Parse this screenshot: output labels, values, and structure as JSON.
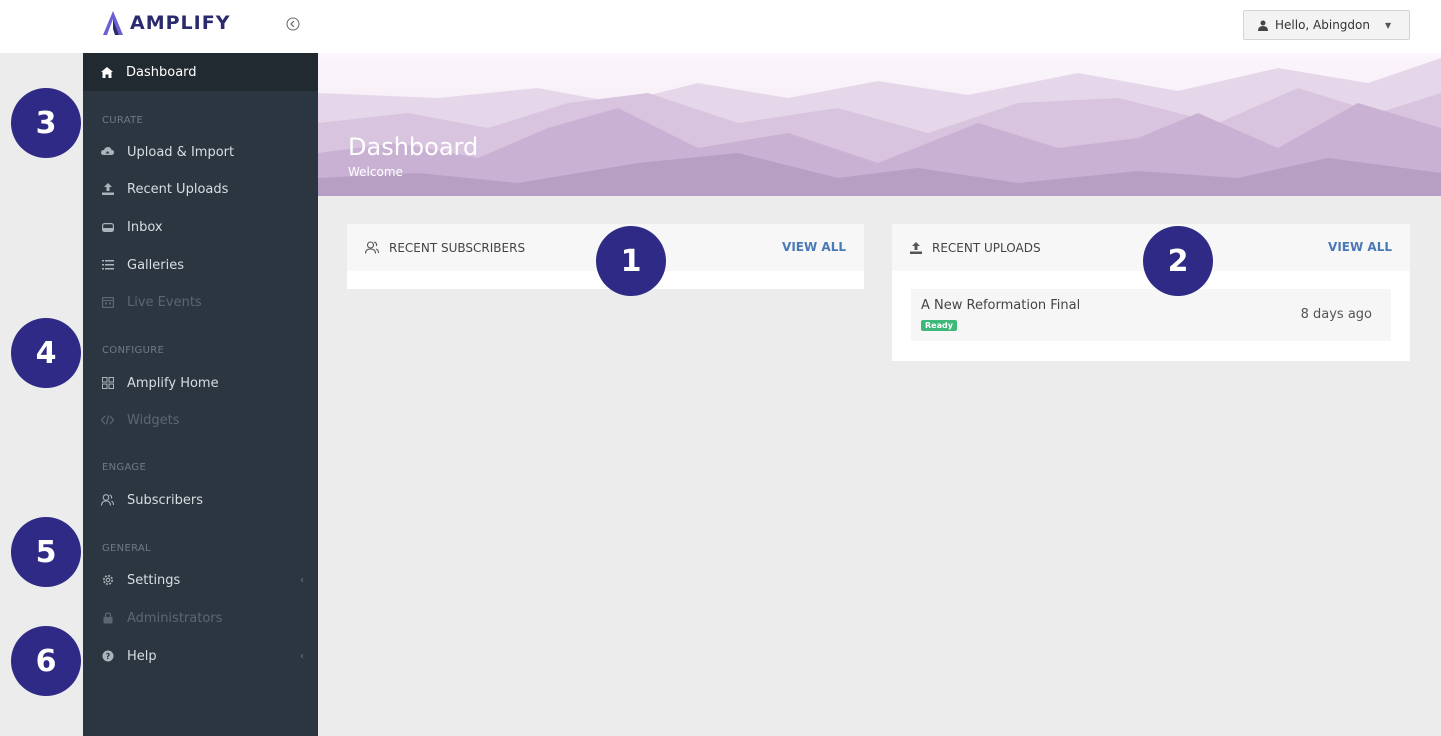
{
  "header": {
    "logo_text": "AMPLIFY",
    "user_greeting": "Hello, Abingdon",
    "brand_color": "#2b2a6e"
  },
  "sidebar": {
    "active_item": {
      "label": "Dashboard",
      "icon": "home-icon"
    },
    "sections": {
      "curate": "CURATE",
      "configure": "CONFIGURE",
      "engage": "ENGAGE",
      "general": "GENERAL"
    },
    "items": {
      "upload_import": {
        "label": "Upload & Import",
        "icon": "cloud-upload-icon"
      },
      "recent_uploads": {
        "label": "Recent Uploads",
        "icon": "upload-icon"
      },
      "inbox": {
        "label": "Inbox",
        "icon": "inbox-icon"
      },
      "galleries": {
        "label": "Galleries",
        "icon": "list-icon"
      },
      "live_events": {
        "label": "Live Events",
        "icon": "calendar-icon"
      },
      "amplify_home": {
        "label": "Amplify Home",
        "icon": "grid-icon"
      },
      "widgets": {
        "label": "Widgets",
        "icon": "code-icon"
      },
      "subscribers": {
        "label": "Subscribers",
        "icon": "users-icon"
      },
      "settings": {
        "label": "Settings",
        "icon": "gear-icon"
      },
      "administrators": {
        "label": "Administrators",
        "icon": "lock-icon"
      },
      "help": {
        "label": "Help",
        "icon": "question-icon"
      }
    }
  },
  "hero": {
    "title": "Dashboard",
    "subtitle": "Welcome"
  },
  "panels": {
    "recent_subscribers": {
      "title": "RECENT SUBSCRIBERS",
      "view_all": "VIEW ALL"
    },
    "recent_uploads": {
      "title": "RECENT UPLOADS",
      "view_all": "VIEW ALL",
      "rows": [
        {
          "title": "A New Reformation Final",
          "status": "Ready",
          "time": "8 days ago"
        }
      ]
    }
  },
  "badges": [
    "1",
    "2",
    "3",
    "4",
    "5",
    "6"
  ],
  "colors": {
    "sidebar_bg": "#2c3640",
    "accent_link": "#4a79b8",
    "badge_bg": "#2e2a86",
    "ready_green": "#3cb878"
  }
}
